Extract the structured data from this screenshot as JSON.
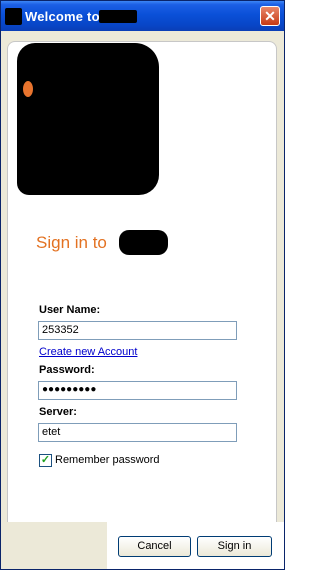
{
  "window": {
    "title": "Welcome to"
  },
  "header": {
    "heading": "Sign in to"
  },
  "form": {
    "username_label": "User Name:",
    "username_value": "253352",
    "create_account_link": "Create new Account",
    "password_label": "Password:",
    "password_value": "●●●●●●●●●",
    "server_label": "Server:",
    "server_value": "etet",
    "remember_label": "Remember password",
    "remember_checked": true
  },
  "buttons": {
    "cancel": "Cancel",
    "signin": "Sign in"
  },
  "colors": {
    "accent": "#e37222",
    "titlebar": "#0a50d8",
    "link": "#0000cc"
  }
}
